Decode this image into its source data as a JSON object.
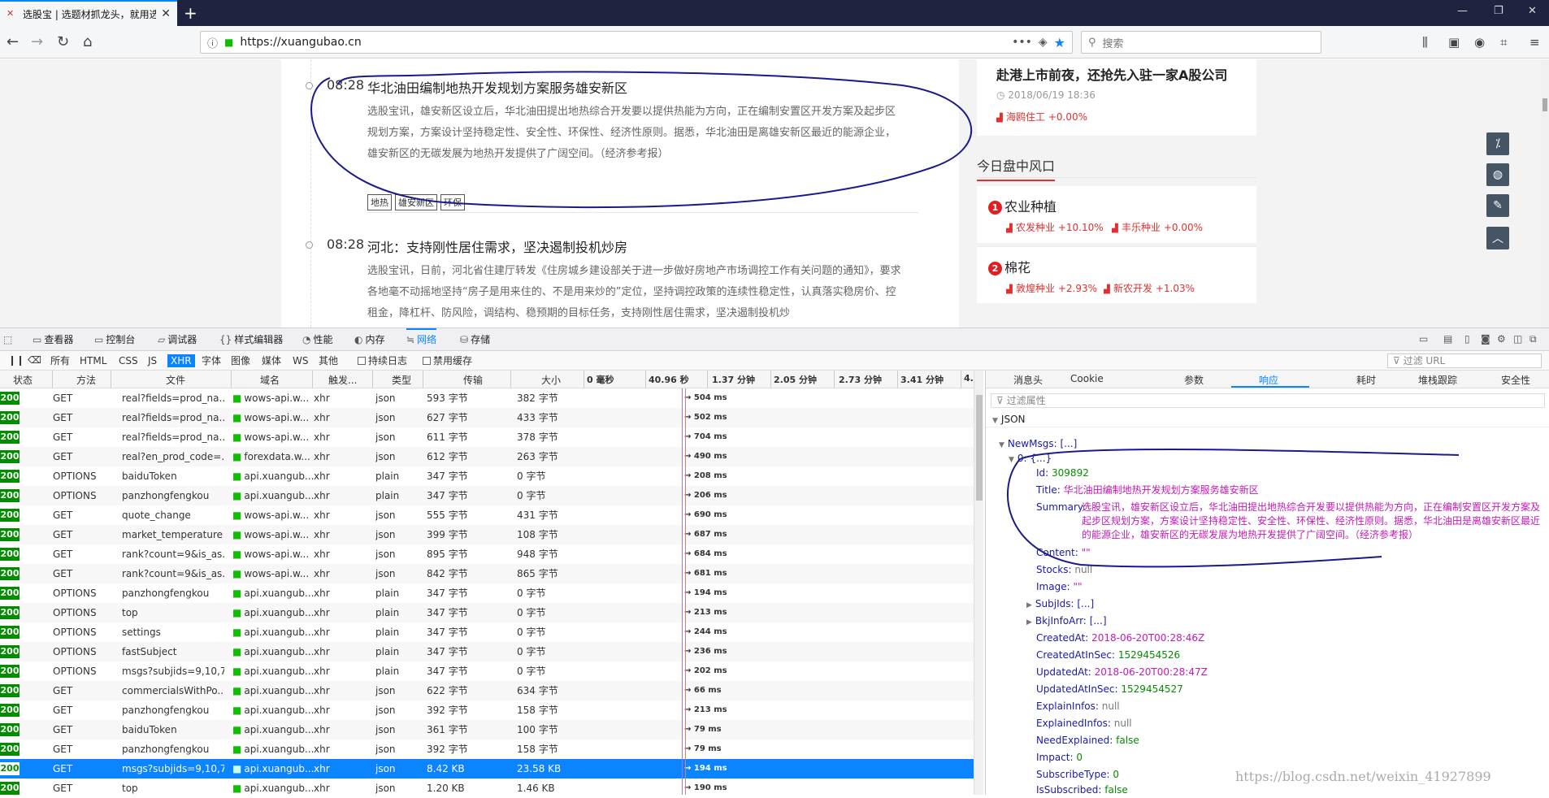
{
  "browser": {
    "tab_title": "选股宝 | 选题材抓龙头，就用选",
    "url": "https://xuangubao.cn",
    "url_actions": "•••",
    "search_placeholder": "搜索"
  },
  "page": {
    "news": [
      {
        "time": "08:28",
        "title": "华北油田编制地热开发规划方案服务雄安新区",
        "body": "选股宝讯，雄安新区设立后，华北油田提出地热综合开发要以提供热能为方向，正在编制安置区开发方案及起步区规划方案，方案设计坚持稳定性、安全性、环保性、经济性原则。据悉，华北油田是离雄安新区最近的能源企业，雄安新区的无碳发展为地热开发提供了广阔空间。（经济参考报）",
        "tags": [
          "地热",
          "雄安新区",
          "环保"
        ]
      },
      {
        "time": "08:28",
        "title": "河北：支持刚性居住需求，坚决遏制投机炒房",
        "body": "选股宝讯，日前，河北省住建厅转发《住房城乡建设部关于进一步做好房地产市场调控工作有关问题的通知》，要求各地毫不动摇地坚持“房子是用来住的、不是用来炒的”定位，坚持调控政策的连续性稳定性，认真落实稳房价、控租金，降杠杆、防风险，调结构、稳预期的目标任务，支持刚性居住需求，坚决遏制投机炒"
      }
    ],
    "side_article": {
      "title": "赴港上市前夜，还抢先入驻一家A股公司",
      "date": "2018/06/19 18:36",
      "stock": "海鸥住工 +0.00%"
    },
    "section_title": "今日盘中风口",
    "sectors": [
      {
        "rank": "1",
        "name": "农业种植",
        "stocks": [
          "农发种业 +10.10%",
          "丰乐种业 +0.00%"
        ]
      },
      {
        "rank": "2",
        "name": "棉花",
        "stocks": [
          "敦煌种业 +2.93%",
          "新农开发 +1.03%"
        ]
      }
    ]
  },
  "devtools": {
    "tabs": [
      "查看器",
      "控制台",
      "调试器",
      "样式编辑器",
      "性能",
      "内存",
      "网络",
      "存储"
    ],
    "filters": [
      "所有",
      "HTML",
      "CSS",
      "JS",
      "XHR",
      "字体",
      "图像",
      "媒体",
      "WS",
      "其他"
    ],
    "persist_log": "持续日志",
    "disable_cache": "禁用缓存",
    "url_filter": "过滤 URL",
    "columns": [
      "状态",
      "方法",
      "文件",
      "域名",
      "触发...",
      "类型",
      "传输",
      "大小"
    ],
    "timeline_ticks": [
      "0 毫秒",
      "40.96 秒",
      "1.37 分钟",
      "2.05 分钟",
      "2.73 分钟",
      "3.41 分钟",
      "4."
    ],
    "requests": [
      {
        "status": "200",
        "method": "GET",
        "file": "real?fields=prod_na...",
        "domain": "wows-api.w...",
        "cause": "xhr",
        "type": "json",
        "transferred": "593 字节",
        "size": "382 字节",
        "time": "→ 504 ms"
      },
      {
        "status": "200",
        "method": "GET",
        "file": "real?fields=prod_na...",
        "domain": "wows-api.w...",
        "cause": "xhr",
        "type": "json",
        "transferred": "627 字节",
        "size": "433 字节",
        "time": "→ 502 ms"
      },
      {
        "status": "200",
        "method": "GET",
        "file": "real?fields=prod_na...",
        "domain": "wows-api.w...",
        "cause": "xhr",
        "type": "json",
        "transferred": "611 字节",
        "size": "378 字节",
        "time": "→ 704 ms"
      },
      {
        "status": "200",
        "method": "GET",
        "file": "real?en_prod_code=...",
        "domain": "forexdata.w...",
        "cause": "xhr",
        "type": "json",
        "transferred": "612 字节",
        "size": "263 字节",
        "time": "→ 490 ms"
      },
      {
        "status": "200",
        "method": "OPTIONS",
        "file": "baiduToken",
        "domain": "api.xuangub...",
        "cause": "xhr",
        "type": "plain",
        "transferred": "347 字节",
        "size": "0 字节",
        "time": "→ 208 ms"
      },
      {
        "status": "200",
        "method": "OPTIONS",
        "file": "panzhongfengkou",
        "domain": "api.xuangub...",
        "cause": "xhr",
        "type": "plain",
        "transferred": "347 字节",
        "size": "0 字节",
        "time": "→ 206 ms"
      },
      {
        "status": "200",
        "method": "GET",
        "file": "quote_change",
        "domain": "wows-api.w...",
        "cause": "xhr",
        "type": "json",
        "transferred": "555 字节",
        "size": "431 字节",
        "time": "→ 690 ms"
      },
      {
        "status": "200",
        "method": "GET",
        "file": "market_temperature",
        "domain": "wows-api.w...",
        "cause": "xhr",
        "type": "json",
        "transferred": "399 字节",
        "size": "108 字节",
        "time": "→ 687 ms"
      },
      {
        "status": "200",
        "method": "GET",
        "file": "rank?count=9&is_as...",
        "domain": "wows-api.w...",
        "cause": "xhr",
        "type": "json",
        "transferred": "895 字节",
        "size": "948 字节",
        "time": "→ 684 ms"
      },
      {
        "status": "200",
        "method": "GET",
        "file": "rank?count=9&is_as...",
        "domain": "wows-api.w...",
        "cause": "xhr",
        "type": "json",
        "transferred": "842 字节",
        "size": "865 字节",
        "time": "→ 681 ms"
      },
      {
        "status": "200",
        "method": "OPTIONS",
        "file": "panzhongfengkou",
        "domain": "api.xuangub...",
        "cause": "xhr",
        "type": "plain",
        "transferred": "347 字节",
        "size": "0 字节",
        "time": "→ 194 ms"
      },
      {
        "status": "200",
        "method": "OPTIONS",
        "file": "top",
        "domain": "api.xuangub...",
        "cause": "xhr",
        "type": "plain",
        "transferred": "347 字节",
        "size": "0 字节",
        "time": "→ 213 ms"
      },
      {
        "status": "200",
        "method": "OPTIONS",
        "file": "settings",
        "domain": "api.xuangub...",
        "cause": "xhr",
        "type": "plain",
        "transferred": "347 字节",
        "size": "0 字节",
        "time": "→ 244 ms"
      },
      {
        "status": "200",
        "method": "OPTIONS",
        "file": "fastSubject",
        "domain": "api.xuangub...",
        "cause": "xhr",
        "type": "plain",
        "transferred": "347 字节",
        "size": "0 字节",
        "time": "→ 236 ms"
      },
      {
        "status": "200",
        "method": "OPTIONS",
        "file": "msgs?subjids=9,10,7...",
        "domain": "api.xuangub...",
        "cause": "xhr",
        "type": "plain",
        "transferred": "347 字节",
        "size": "0 字节",
        "time": "→ 202 ms"
      },
      {
        "status": "200",
        "method": "GET",
        "file": "commercialsWithPo...",
        "domain": "api.xuangub...",
        "cause": "xhr",
        "type": "json",
        "transferred": "622 字节",
        "size": "634 字节",
        "time": "→ 66 ms"
      },
      {
        "status": "200",
        "method": "GET",
        "file": "panzhongfengkou",
        "domain": "api.xuangub...",
        "cause": "xhr",
        "type": "json",
        "transferred": "392 字节",
        "size": "158 字节",
        "time": "→ 213 ms"
      },
      {
        "status": "200",
        "method": "GET",
        "file": "baiduToken",
        "domain": "api.xuangub...",
        "cause": "xhr",
        "type": "json",
        "transferred": "361 字节",
        "size": "100 字节",
        "time": "→ 79 ms"
      },
      {
        "status": "200",
        "method": "GET",
        "file": "panzhongfengkou",
        "domain": "api.xuangub...",
        "cause": "xhr",
        "type": "json",
        "transferred": "392 字节",
        "size": "158 字节",
        "time": "→ 79 ms"
      },
      {
        "status": "200",
        "method": "GET",
        "file": "msgs?subjids=9,10,7...",
        "domain": "api.xuangub...",
        "cause": "xhr",
        "type": "json",
        "transferred": "8.42 KB",
        "size": "23.58 KB",
        "time": "→ 194 ms",
        "selected": true
      },
      {
        "status": "200",
        "method": "GET",
        "file": "top",
        "domain": "api.xuangub...",
        "cause": "xhr",
        "type": "json",
        "transferred": "1.20 KB",
        "size": "1.46 KB",
        "time": "→ 190 ms"
      }
    ],
    "detail_tabs": [
      "消息头",
      "Cookie",
      "参数",
      "响应",
      "耗时",
      "堆栈跟踪",
      "安全性"
    ],
    "prop_filter": "过滤属性",
    "json_label": "JSON",
    "json": {
      "root_key": "NewMsgs:",
      "root_val": "[...]",
      "item_key": "0:",
      "item_val": "{...}",
      "id_key": "Id:",
      "id_val": "309892",
      "title_key": "Title:",
      "title_val": "华北油田编制地热开发规划方案服务雄安新区",
      "summary_key": "Summary:",
      "summary_val": "选股宝讯，雄安新区设立后，华北油田提出地热综合开发要以提供热能为方向，正在编制安置区开发方案及起步区规划方案，方案设计坚持稳定性、安全性、环保性、经济性原则。据悉，华北油田是离雄安新区最近的能源企业，雄安新区的无碳发展为地热开发提供了广阔空间。（经济参考报）",
      "content_key": "Content:",
      "content_val": "\"\"",
      "stocks_key": "Stocks:",
      "stocks_val": "null",
      "image_key": "Image:",
      "image_val": "\"\"",
      "subj_key": "SubjIds:",
      "subj_val": "[...]",
      "bkj_key": "BkjInfoArr:",
      "bkj_val": "[...]",
      "created_key": "CreatedAt:",
      "created_val": "2018-06-20T00:28:46Z",
      "createdsec_key": "CreatedAtInSec:",
      "createdsec_val": "1529454526",
      "updated_key": "UpdatedAt:",
      "updated_val": "2018-06-20T00:28:47Z",
      "updatedsec_key": "UpdatedAtInSec:",
      "updatedsec_val": "1529454527",
      "explain_key": "ExplainInfos:",
      "explain_val": "null",
      "explained_key": "ExplainedInfos:",
      "explained_val": "null",
      "need_key": "NeedExplained:",
      "need_val": "false",
      "impact_key": "Impact:",
      "impact_val": "0",
      "subtype_key": "SubscribeType:",
      "subtype_val": "0",
      "issub_key": "IsSubscribed:",
      "issub_val": "false"
    },
    "watermark": "https://blog.csdn.net/weixin_41927899"
  },
  "colors": {
    "accent": "#0a84ff",
    "status_ok": "#058b00",
    "stock_red": "#e03030",
    "annotation_ink": "#1a1a8c"
  }
}
